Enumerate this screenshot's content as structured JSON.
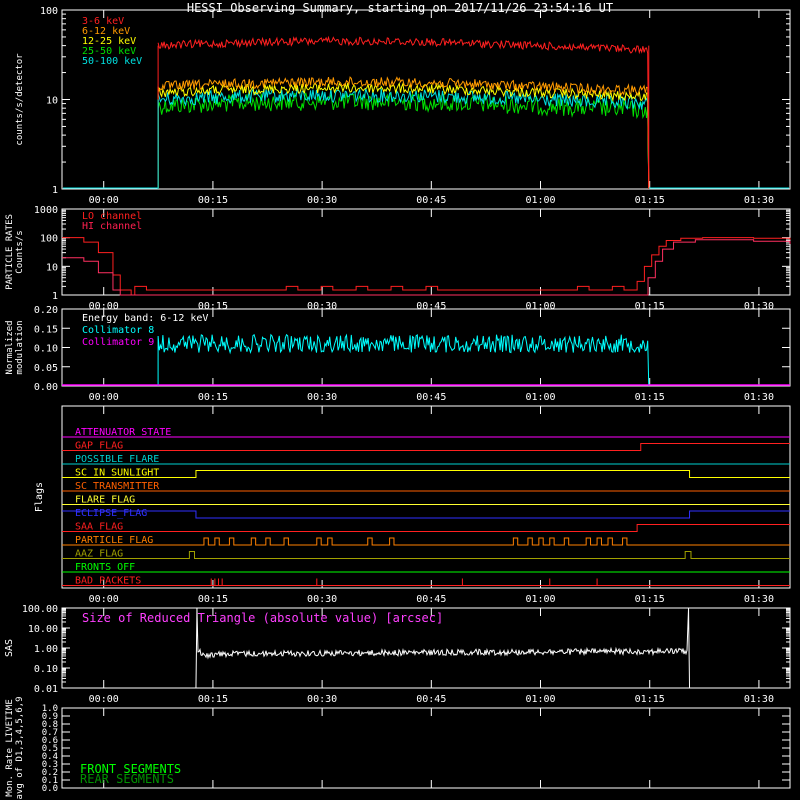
{
  "title": "HESSI Observing Summary, starting on 2017/11/26 23:54:16 UT",
  "time_axis": {
    "tick_labels": [
      "00:00",
      "00:15",
      "00:30",
      "00:45",
      "01:00",
      "01:15",
      "01:30"
    ],
    "tick_minutes_from_start": [
      5.73,
      20.73,
      35.73,
      50.73,
      65.73,
      80.73,
      95.73
    ],
    "range_minutes_from_start": [
      0,
      100
    ]
  },
  "chart_data": [
    {
      "id": "lightcurves",
      "type": "line",
      "ylabel": "counts/s/detector",
      "yscale": "log",
      "ylim": [
        1,
        100
      ],
      "ytick_labels": [
        "1",
        "10",
        "100"
      ],
      "observation_window_minutes": [
        13.2,
        80.6
      ],
      "series": [
        {
          "name": "3-6 keV",
          "color": "#ff2020",
          "level": 40
        },
        {
          "name": "6-12 keV",
          "color": "#ff9a00",
          "level": 14
        },
        {
          "name": "12-25 keV",
          "color": "#ffff00",
          "level": 12
        },
        {
          "name": "25-50 keV",
          "color": "#00e000",
          "level": 8.5
        },
        {
          "name": "50-100 keV",
          "color": "#00e0e0",
          "level": 10
        }
      ]
    },
    {
      "id": "particle",
      "type": "line",
      "ylabel_lines": [
        "PARTICLE RATES",
        "Counts/s"
      ],
      "yscale": "log",
      "ylim": [
        1,
        1000
      ],
      "ytick_labels": [
        "1",
        "10",
        "100",
        "1000"
      ],
      "series": [
        {
          "name": "LO channel",
          "color": "#ff2020"
        },
        {
          "name": "HI channel",
          "color": "#ff2050"
        }
      ]
    },
    {
      "id": "modulation",
      "type": "line",
      "ylabel_lines": [
        "Normalized",
        "modulation"
      ],
      "ylim": [
        0,
        0.2
      ],
      "ytick_labels": [
        "0.00",
        "0.05",
        "0.10",
        "0.15",
        "0.20"
      ],
      "annotation": "Energy band: 6-12 keV",
      "series": [
        {
          "name": "Collimator 8",
          "color": "#00ffff",
          "level": 0.11
        },
        {
          "name": "Collimator 9",
          "color": "#ff00ff",
          "level": 0.0
        }
      ]
    },
    {
      "id": "flags",
      "type": "line",
      "ylabel": "Flags",
      "flags": [
        {
          "name": "ATTENUATOR_STATE",
          "color": "#ff00ff"
        },
        {
          "name": "GAP_FLAG",
          "color": "#ff2020"
        },
        {
          "name": "POSSIBLE_FLARE",
          "color": "#00d0d0"
        },
        {
          "name": "SC_IN_SUNLIGHT",
          "color": "#ffff00"
        },
        {
          "name": "SC_TRANSMITTER",
          "color": "#ff6000"
        },
        {
          "name": "FLARE_FLAG",
          "color": "#ffff30"
        },
        {
          "name": "ECLIPSE_FLAG",
          "color": "#3030ff"
        },
        {
          "name": "SAA_FLAG",
          "color": "#ff2020"
        },
        {
          "name": "PARTICLE_FLAG",
          "color": "#ff8000"
        },
        {
          "name": "AAZ_FLAG",
          "color": "#a0a000"
        },
        {
          "name": "FRONTS_OFF",
          "color": "#00ff00"
        },
        {
          "name": "BAD_PACKETS",
          "color": "#ff2020"
        }
      ]
    },
    {
      "id": "sas",
      "type": "line",
      "ylabel": "SAS",
      "yscale": "log",
      "ylim": [
        0.01,
        100
      ],
      "ytick_labels": [
        "0.01",
        "0.10",
        "1.00",
        "10.00",
        "100.00"
      ],
      "annotation": "Size of Reduced Triangle (absolute value) [arcsec]",
      "annotation_color": "#ff40ff",
      "window_minutes": [
        18.4,
        86.2
      ]
    },
    {
      "id": "livetime",
      "type": "line",
      "ylabel_lines": [
        "Mon. Rate LIVETIME",
        "avg of D1,3,4,5,6,9"
      ],
      "ylim": [
        0,
        1
      ],
      "ytick_labels": [
        "0.0",
        "0.1",
        "0.2",
        "0.3",
        "0.4",
        "0.5",
        "0.6",
        "0.7",
        "0.8",
        "0.9",
        "1.0"
      ],
      "series": [
        {
          "name": "FRONT SEGMENTS",
          "color": "#00ff00"
        },
        {
          "name": "REAR SEGMENTS",
          "color": "#009000"
        }
      ]
    }
  ]
}
